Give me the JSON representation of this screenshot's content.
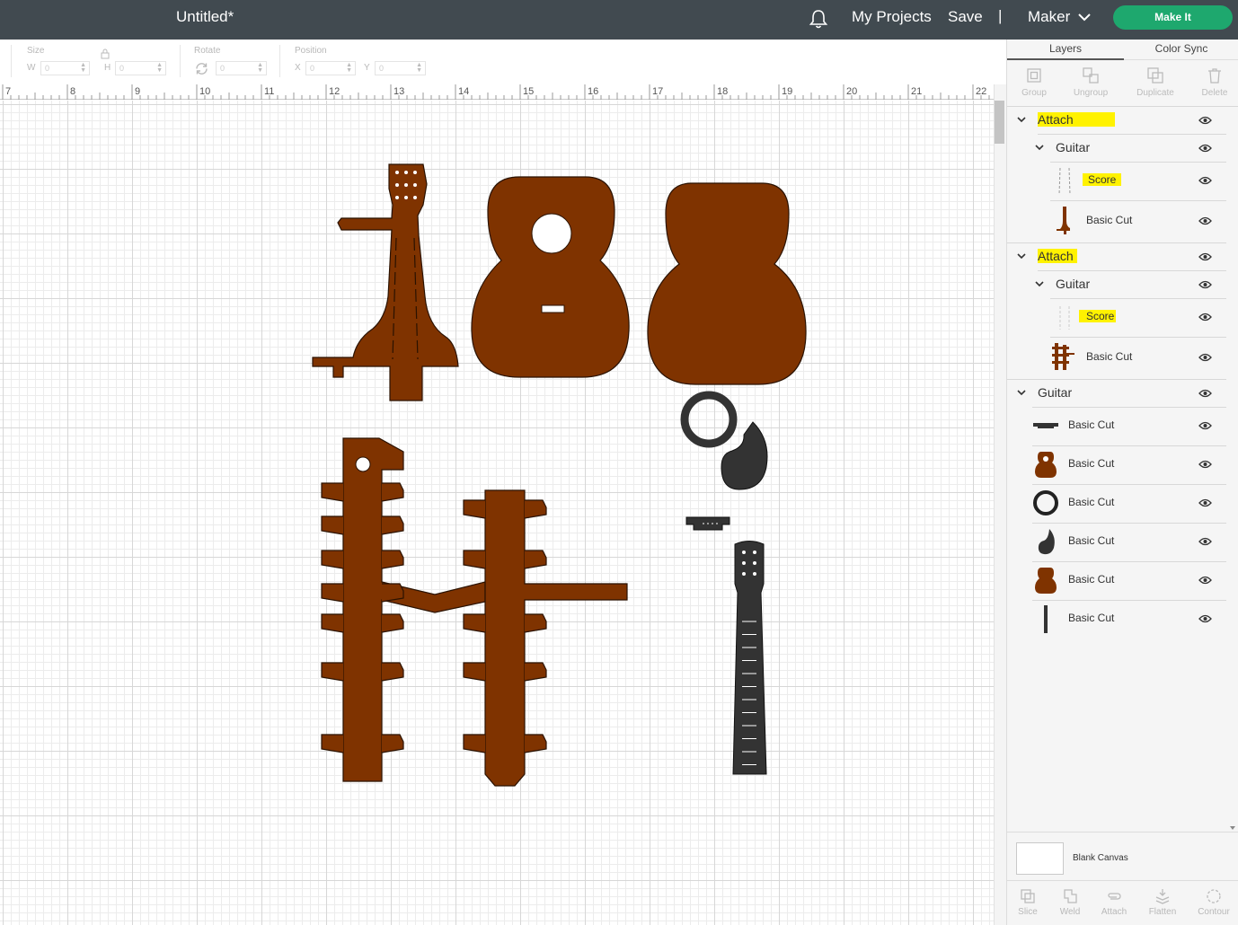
{
  "topbar": {
    "title": "Untitled*",
    "my_projects": "My Projects",
    "save": "Save",
    "divider": "|",
    "machine": "Maker",
    "make_it": "Make It",
    "bg_color": "#414a50",
    "make_it_color": "#1ea86e"
  },
  "edit_toolbar": {
    "size_label": "Size",
    "w_label": "W",
    "w_value": "0",
    "h_label": "H",
    "h_value": "0",
    "rotate_label": "Rotate",
    "rotate_value": "0",
    "position_label": "Position",
    "x_label": "X",
    "x_value": "0",
    "y_label": "Y",
    "y_value": "0"
  },
  "ruler": {
    "numbers": [
      "7",
      "8",
      "9",
      "10",
      "11",
      "12",
      "13",
      "14",
      "15",
      "16",
      "17",
      "18",
      "19",
      "20",
      "21",
      "22"
    ]
  },
  "canvas": {
    "cut_color": "#7f3300",
    "dark_color": "#333333"
  },
  "panel": {
    "tabs": [
      "Layers",
      "Color Sync"
    ],
    "tools": [
      "Group",
      "Ungroup",
      "Duplicate",
      "Delete"
    ],
    "layers": [
      {
        "label": "Attach",
        "highlighted": true
      },
      {
        "label": "Guitar"
      },
      {
        "label": "Score",
        "highlighted": true
      },
      {
        "label": "Basic Cut"
      },
      {
        "label": "Attach",
        "highlighted": true
      },
      {
        "label": "Guitar"
      },
      {
        "label": "Score",
        "highlighted": true
      },
      {
        "label": "Basic Cut"
      },
      {
        "label": "Guitar"
      },
      {
        "label": "Basic Cut"
      },
      {
        "label": "Basic Cut"
      },
      {
        "label": "Basic Cut"
      },
      {
        "label": "Basic Cut"
      },
      {
        "label": "Basic Cut"
      },
      {
        "label": "Basic Cut"
      }
    ],
    "blank_canvas": "Blank Canvas",
    "bottom_tools": [
      "Slice",
      "Weld",
      "Attach",
      "Flatten",
      "Contour"
    ],
    "highlight_color": "#fff200"
  }
}
